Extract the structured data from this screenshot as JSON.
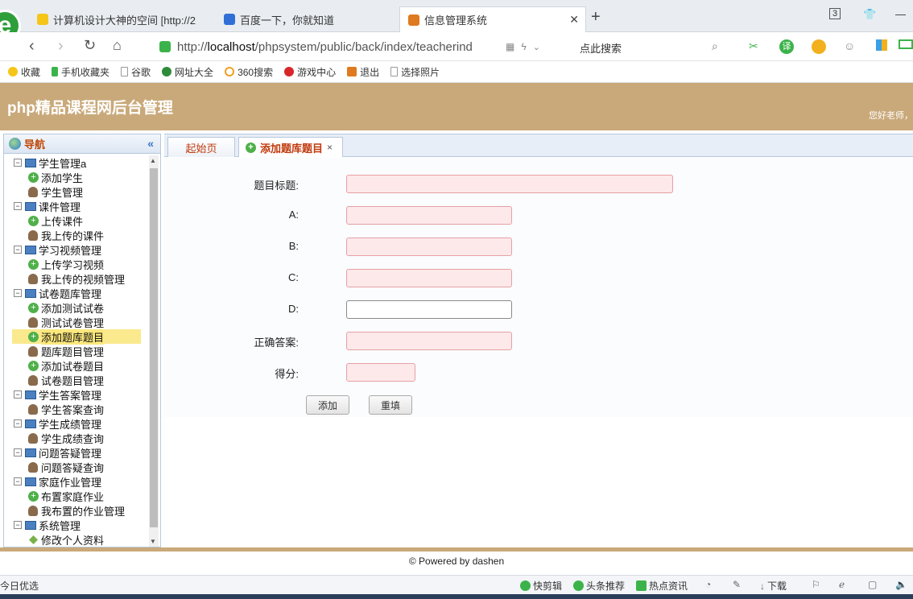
{
  "browser": {
    "tabs": [
      {
        "title": "计算机设计大神的空间 [http://2",
        "active": false
      },
      {
        "title": "百度一下，你就知道",
        "active": false
      },
      {
        "title": "信息管理系统",
        "active": true
      }
    ],
    "tab_count": "3",
    "url_prefix": "http://",
    "url_host": "localhost",
    "url_path": "/phpsystem/public/back/index/teacherind",
    "search_hint": "点此搜索",
    "bookmarks": [
      "收藏",
      "手机收藏夹",
      "谷歌",
      "网址大全",
      "360搜索",
      "游戏中心",
      "退出",
      "选择照片"
    ]
  },
  "app": {
    "title": "php精品课程网后台管理",
    "greeting": "您好老师，"
  },
  "sidebar": {
    "title": "导航",
    "tree": [
      {
        "label": "学生管理a",
        "children": [
          "添加学生",
          "学生管理"
        ]
      },
      {
        "label": "课件管理",
        "children": [
          "上传课件",
          "我上传的课件"
        ]
      },
      {
        "label": "学习视频管理",
        "children": [
          "上传学习视频",
          "我上传的视频管理"
        ]
      },
      {
        "label": "试卷题库管理",
        "children": [
          "添加测试试卷",
          "测试试卷管理",
          "添加题库题目",
          "题库题目管理",
          "添加试卷题目",
          "试卷题目管理"
        ]
      },
      {
        "label": "学生答案管理",
        "children": [
          "学生答案查询"
        ]
      },
      {
        "label": "学生成绩管理",
        "children": [
          "学生成绩查询"
        ]
      },
      {
        "label": "问题答疑管理",
        "children": [
          "问题答疑查询"
        ]
      },
      {
        "label": "家庭作业管理",
        "children": [
          "布置家庭作业",
          "我布置的作业管理"
        ]
      },
      {
        "label": "系统管理",
        "children": [
          "修改个人资料"
        ]
      }
    ],
    "selected": "添加题库题目"
  },
  "content": {
    "tabs": [
      {
        "label": "起始页",
        "active": false
      },
      {
        "label": "添加题库题目",
        "active": true,
        "closable": true
      }
    ],
    "form": {
      "fields": [
        {
          "label": "题目标题:",
          "value": ""
        },
        {
          "label": "A:",
          "value": ""
        },
        {
          "label": "B:",
          "value": ""
        },
        {
          "label": "C:",
          "value": ""
        },
        {
          "label": "D:",
          "value": ""
        },
        {
          "label": "正确答案:",
          "value": ""
        },
        {
          "label": "得分:",
          "value": ""
        }
      ],
      "submit_label": "添加",
      "reset_label": "重填"
    }
  },
  "footer": {
    "powered": "© Powered by dashen"
  },
  "statusbar": {
    "left": "今日优选",
    "items": [
      "快剪辑",
      "头条推荐",
      "热点资讯",
      "下载"
    ]
  }
}
